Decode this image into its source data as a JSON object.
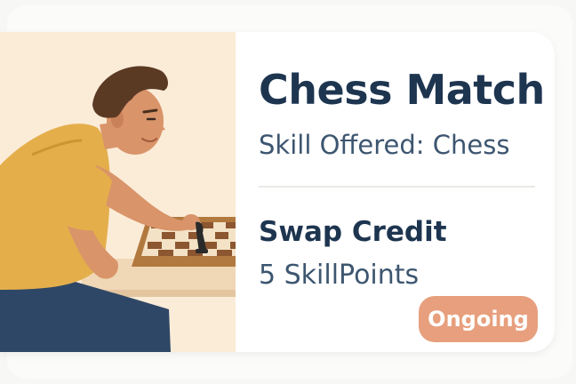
{
  "card": {
    "title": "Chess Match",
    "skill_label": "Skill Offered:",
    "skill_value": "Chess",
    "credit_heading": "Swap Credit",
    "credit_value": "5 SkillPoints",
    "status": "Ongoing"
  },
  "colors": {
    "title": "#1e3550",
    "body_text": "#3d5670",
    "badge_background": "#e79f7d",
    "badge_text": "#ffffff",
    "illustration_background": "#fbecd8"
  },
  "illustration": {
    "subject": "person-playing-chess"
  }
}
